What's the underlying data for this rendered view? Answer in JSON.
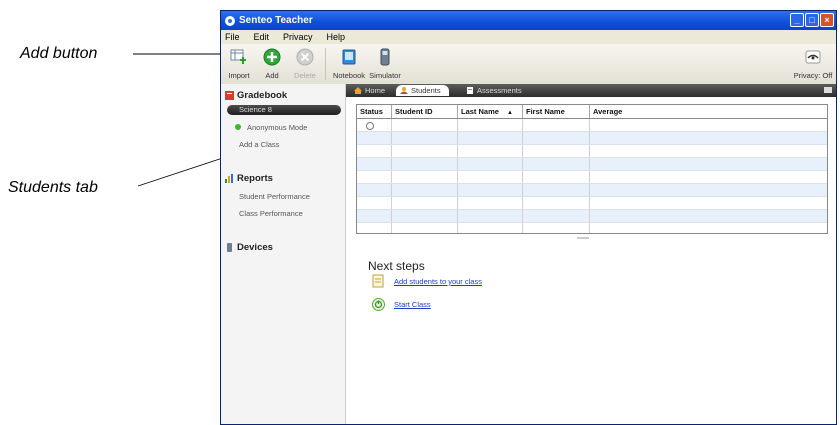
{
  "callouts": {
    "add_button": "Add button",
    "students_tab": "Students tab"
  },
  "window": {
    "title": "Senteo Teacher",
    "title_color": "#0d50d8"
  },
  "menu": [
    "File",
    "Edit",
    "Privacy",
    "Help"
  ],
  "toolbar": {
    "import": "Import",
    "add": "Add",
    "delete": "Delete",
    "notebook": "Notebook",
    "simulator": "Simulator",
    "privacy": "Privacy: Off"
  },
  "sidebar": {
    "gradebook": "Gradebook",
    "class_name": "Science 8",
    "anonymous_mode": "Anonymous Mode",
    "add_class": "Add a Class",
    "reports": "Reports",
    "student_performance": "Student Performance",
    "class_performance": "Class Performance",
    "devices": "Devices"
  },
  "tabs": {
    "home": "Home",
    "students": "Students",
    "assessments": "Assessments"
  },
  "table": {
    "columns": [
      "Status",
      "Student ID",
      "Last Name",
      "First Name",
      "Average"
    ],
    "sort_indicator": "▲"
  },
  "next_steps": {
    "heading": "Next steps",
    "add_students": "Add students to your class",
    "start_class": "Start Class"
  }
}
